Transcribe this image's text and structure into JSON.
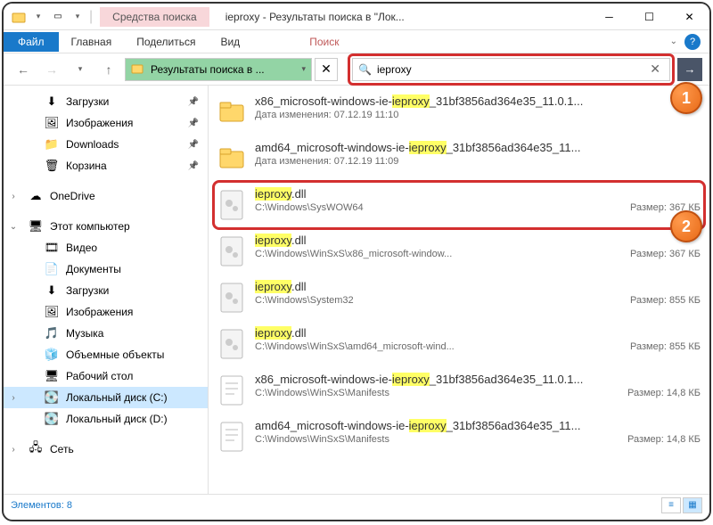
{
  "title": "ieproxy - Результаты поиска в \"Лок...",
  "contextual_tab_label": "Средства поиска",
  "ribbon": {
    "file": "Файл",
    "home": "Главная",
    "share": "Поделиться",
    "view": "Вид",
    "search": "Поиск"
  },
  "breadcrumb": "Результаты поиска в ...",
  "search": {
    "value": "ieproxy"
  },
  "sidebar": {
    "quick": [
      {
        "label": "Загрузки",
        "icon": "⬇",
        "pin": true
      },
      {
        "label": "Изображения",
        "icon": "🖼",
        "pin": true
      },
      {
        "label": "Downloads",
        "icon": "📁",
        "pin": true
      },
      {
        "label": "Корзина",
        "icon": "🗑",
        "pin": true
      }
    ],
    "onedrive": "OneDrive",
    "thispc": "Этот компьютер",
    "thispc_items": [
      {
        "label": "Видео",
        "icon": "🎞"
      },
      {
        "label": "Документы",
        "icon": "📄"
      },
      {
        "label": "Загрузки",
        "icon": "⬇"
      },
      {
        "label": "Изображения",
        "icon": "🖼"
      },
      {
        "label": "Музыка",
        "icon": "🎵"
      },
      {
        "label": "Объемные объекты",
        "icon": "🧊"
      },
      {
        "label": "Рабочий стол",
        "icon": "🖥"
      },
      {
        "label": "Локальный диск (C:)",
        "icon": "💽",
        "sel": true
      },
      {
        "label": "Локальный диск (D:)",
        "icon": "💽"
      }
    ],
    "network": "Сеть"
  },
  "results": [
    {
      "type": "folder",
      "name_pre": "x86_microsoft-windows-ie-",
      "name_hl": "ieproxy",
      "name_post": "_31bf3856ad364e35_11.0.1...",
      "meta_left": "Дата изменения: 07.12.19 11:10",
      "meta_right": ""
    },
    {
      "type": "folder",
      "name_pre": "amd64_microsoft-windows-ie-",
      "name_hl": "ieproxy",
      "name_post": "_31bf3856ad364e35_11...",
      "meta_left": "Дата изменения: 07.12.19 11:09",
      "meta_right": ""
    },
    {
      "type": "dll",
      "name_pre": "",
      "name_hl": "ieproxy",
      "name_post": ".dll",
      "meta_left": "C:\\Windows\\SysWOW64",
      "meta_right": "Размер: 367 КБ",
      "callout": true
    },
    {
      "type": "dll",
      "name_pre": "",
      "name_hl": "ieproxy",
      "name_post": ".dll",
      "meta_left": "C:\\Windows\\WinSxS\\x86_microsoft-window...",
      "meta_right": "Размер: 367 КБ"
    },
    {
      "type": "dll",
      "name_pre": "",
      "name_hl": "ieproxy",
      "name_post": ".dll",
      "meta_left": "C:\\Windows\\System32",
      "meta_right": "Размер: 855 КБ"
    },
    {
      "type": "dll",
      "name_pre": "",
      "name_hl": "ieproxy",
      "name_post": ".dll",
      "meta_left": "C:\\Windows\\WinSxS\\amd64_microsoft-wind...",
      "meta_right": "Размер: 855 КБ"
    },
    {
      "type": "txt",
      "name_pre": "x86_microsoft-windows-ie-",
      "name_hl": "ieproxy",
      "name_post": "_31bf3856ad364e35_11.0.1...",
      "meta_left": "C:\\Windows\\WinSxS\\Manifests",
      "meta_right": "Размер: 14,8 КБ"
    },
    {
      "type": "txt",
      "name_pre": "amd64_microsoft-windows-ie-",
      "name_hl": "ieproxy",
      "name_post": "_31bf3856ad364e35_11...",
      "meta_left": "C:\\Windows\\WinSxS\\Manifests",
      "meta_right": "Размер: 14,8 КБ"
    }
  ],
  "status": "Элементов: 8",
  "callouts": {
    "1": "1",
    "2": "2"
  }
}
